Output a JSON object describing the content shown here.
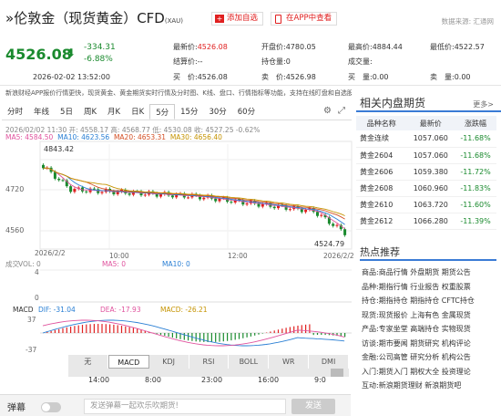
{
  "header": {
    "title": "伦敦金（现货黄金）CFD",
    "title_prefix": "»",
    "code": "(XAU)",
    "add_watch": "添加自选",
    "app_view": "在APP中查看",
    "source": "数据来源: 汇通网"
  },
  "quote": {
    "price": "4526.08",
    "change": "-334.31",
    "change_pct": "-6.88%",
    "time": "2026-02-02 13:52:00",
    "stats": [
      {
        "k": "最新价:",
        "v": "4526.08",
        "color": "#e02020"
      },
      {
        "k": "开盘价:",
        "v": "4780.05",
        "color": "#333"
      },
      {
        "k": "最高价:",
        "v": "4884.44",
        "color": "#333"
      },
      {
        "k": "最低价:",
        "v": "4522.57",
        "color": "#333"
      },
      {
        "k": "结算价:",
        "v": "--",
        "color": "#333"
      },
      {
        "k": "持仓量:",
        "v": "0",
        "color": "#333"
      },
      {
        "k": "成交量:",
        "v": "",
        "color": "#333"
      },
      {
        "k": "",
        "v": "",
        "color": "#333"
      },
      {
        "k": "买　价:",
        "v": "4526.08",
        "color": "#333"
      },
      {
        "k": "卖　价:",
        "v": "4526.98",
        "color": "#333"
      },
      {
        "k": "买　量:",
        "v": "0.00",
        "color": "#333"
      },
      {
        "k": "卖　量:",
        "v": "0.00",
        "color": "#333"
      }
    ]
  },
  "notice": "新浪财经APP报价行情更快，现货黄金、黄金期货实时行情及分时图、K线、盘口、行情指标等功能，支持在线盯盘和自选股同步提醒",
  "tabs": [
    "分时",
    "年线",
    "5日",
    "周K",
    "月K",
    "日K",
    "5分",
    "15分",
    "30分",
    "60分"
  ],
  "active_tab": "5分",
  "chart_legend": {
    "header": "2026/02/02 11:30  开: 4558.17  高: 4568.77  低: 4530.08  收: 4527.25  -0.62%",
    "ma5": "MA5: 4584.50",
    "ma10": "MA10: 4623.56",
    "ma20": "MA20: 4653.31",
    "ma30": "MA30: 4656.40",
    "max_label": "4843.42",
    "min_label": "4524.79",
    "y_ticks": [
      "4720",
      "4560"
    ],
    "x_ticks": [
      "2026/2/2",
      "10:00",
      "12:00",
      "2026/2/2"
    ],
    "vol_label": "成交",
    "vol_vals": "VOL: 0",
    "vol_ma5": "MA5: 0",
    "vol_ma10": "MA10: 0",
    "vol_y_top": "4",
    "vol_y_bot": "0",
    "macd_label": "MACD",
    "macd_dif": "DIF: -31.04",
    "macd_dea": "DEA: -17.93",
    "macd_macd": "MACD: -26.21",
    "macd_y_top": "37",
    "macd_y_bot": "-37",
    "bottom_times": [
      "14:00",
      "8:00",
      "23:00",
      "16:00",
      "9:0"
    ]
  },
  "indicator_tabs": [
    "无",
    "MACD",
    "KDJ",
    "RSI",
    "BOLL",
    "WR",
    "DMI"
  ],
  "active_indicator": "MACD",
  "related": {
    "title": "相关内盘期货",
    "more": "更多>",
    "columns": [
      "品种名称",
      "最新价",
      "涨跌幅"
    ],
    "rows": [
      [
        "黄金连续",
        "1057.060",
        "-11.68%"
      ],
      [
        "黄金2604",
        "1057.060",
        "-11.68%"
      ],
      [
        "黄金2606",
        "1059.380",
        "-11.72%"
      ],
      [
        "黄金2608",
        "1060.960",
        "-11.83%"
      ],
      [
        "黄金2610",
        "1063.720",
        "-11.60%"
      ],
      [
        "黄金2612",
        "1066.280",
        "-11.39%"
      ]
    ]
  },
  "hot": {
    "title": "热点推荐",
    "rows": [
      {
        "k": "商品:",
        "v": "商品行情 外盘期货 期货公告"
      },
      {
        "k": "品种:",
        "v": "期指行情 行业报告 权重股票"
      },
      {
        "k": "持仓:",
        "v": "期指持仓 期指持仓 CFTC持仓"
      },
      {
        "k": "现货:",
        "v": "现货报价 上海有色 金属现货"
      },
      {
        "k": "产品:",
        "v": "专家坐堂 高端持仓 实物现货"
      },
      {
        "k": "访谈:",
        "v": "期市要闻 期货研究 机构评论"
      },
      {
        "k": "金融:",
        "v": "公司高管 研究分析 机构公告"
      },
      {
        "k": "入门:",
        "v": "期货入门 期权大全 投资理论"
      },
      {
        "k": "互动:",
        "v": "新浪期货理财 新浪期货吧"
      }
    ]
  },
  "danmu": {
    "label": "弹幕",
    "placeholder": "发送弹幕一起欢乐吹期货!",
    "send": "发送"
  }
}
